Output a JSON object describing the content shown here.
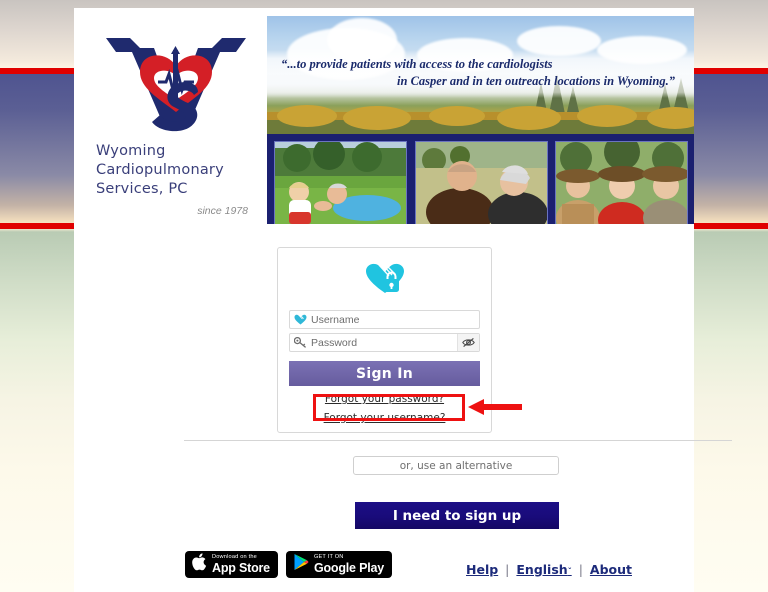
{
  "page": {
    "background_bands": [
      "#c9c4c0",
      "#f3e9dc",
      "#4f5490",
      "#8a8aa6",
      "#b9cbb4",
      "#fffdf2"
    ],
    "rule_color": "#e00000"
  },
  "header": {
    "logo_icon": "wcs-caduceus-heart-logo",
    "org_name_lines": [
      "Wyoming",
      "Cardiopulmonary",
      "Services, PC"
    ],
    "since": "since 1978",
    "banner": {
      "quote_line1": "“...to provide patients with access to the cardiologists",
      "quote_line2": "in Casper and in ten outreach locations in Wyoming.”",
      "photos": [
        {
          "name": "photo-toddler-and-grandfather"
        },
        {
          "name": "photo-senior-couple"
        },
        {
          "name": "photo-three-women-in-hats"
        }
      ]
    }
  },
  "login": {
    "brand_icon": "heart-lock-icon",
    "username": {
      "icon": "heart-icon",
      "placeholder": "Username",
      "value": ""
    },
    "password": {
      "icon": "key-icon",
      "placeholder": "Password",
      "value": "",
      "toggle_icon": "eye-slash-icon"
    },
    "signin_label": "Sign In",
    "forgot_password_label": "Forgot your password?",
    "forgot_username_label": "Forgot your username?",
    "signin_color": "#665c9e"
  },
  "annotation": {
    "target": "forgot-your-username-link",
    "box_color": "#ee1111",
    "arrow_icon": "left-arrow-icon"
  },
  "alternatives": {
    "alt_label": "or, use an alternative",
    "signup_label": "I need to sign up",
    "signup_color": "#190b7a"
  },
  "footer": {
    "app_store": {
      "icon": "apple-icon",
      "top_line": "Download on the",
      "main_line": "App Store"
    },
    "google_play": {
      "icon": "google-play-icon",
      "top_line": "GET IT ON",
      "main_line": "Google Play"
    },
    "links": [
      {
        "label": "Help"
      },
      {
        "label": "English",
        "caret": "ˇ"
      },
      {
        "label": "About"
      }
    ],
    "separator": "|",
    "link_color": "#1c2a7a"
  }
}
